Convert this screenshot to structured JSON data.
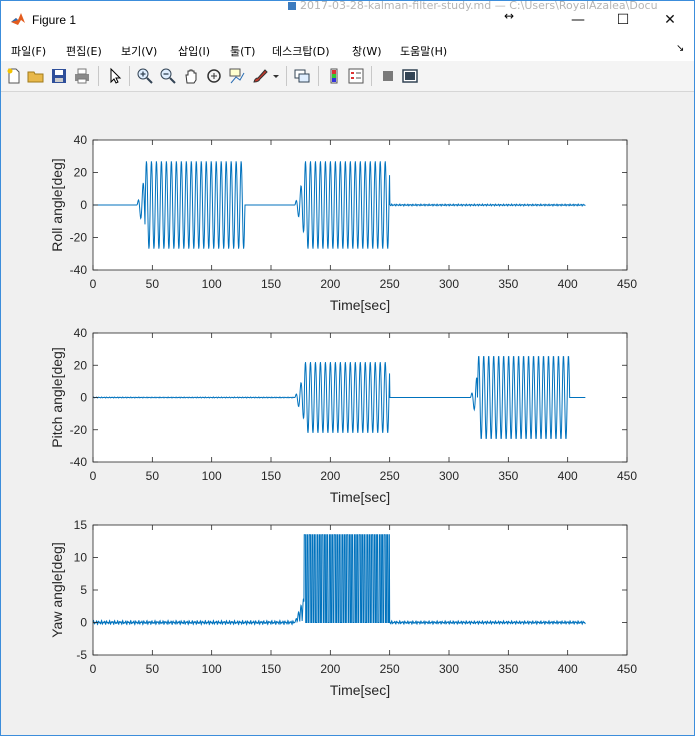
{
  "window": {
    "title": "Figure 1",
    "background_title": "2017-03-28-kalman-filter-study.md — C:\\Users\\RoyalAzalea\\Docu",
    "controls": {
      "minimize": "—",
      "maximize": "☐",
      "close": "✕"
    },
    "resize_glyph": "↔"
  },
  "menu": {
    "items": [
      "파일(F)",
      "편집(E)",
      "보기(V)",
      "삽입(I)",
      "툴(T)",
      "데스크탑(D)",
      "창(W)",
      "도움말(H)"
    ],
    "overflow_arrow": "↘"
  },
  "toolbar": {
    "icons": [
      "new-figure-icon",
      "open-file-icon",
      "save-icon",
      "print-icon",
      "pointer-icon",
      "zoom-in-icon",
      "zoom-out-icon",
      "pan-icon",
      "rotate-3d-icon",
      "data-cursor-icon",
      "brush-icon",
      "brush-dropdown-icon",
      "link-plot-icon",
      "colorbar-icon",
      "legend-icon",
      "hide-plot-tools-icon",
      "show-plot-tools-icon"
    ]
  },
  "colors": {
    "line": "#0072bd",
    "axes_bg": "#ffffff",
    "figure_bg": "#f0f0f0",
    "title_bar_border": "#3c8ddb"
  },
  "chart_data": [
    {
      "type": "line",
      "ylabel": "Roll angle[deg]",
      "xlabel": "Time[sec]",
      "xlim": [
        0,
        450
      ],
      "ylim": [
        -40,
        40
      ],
      "xticks": [
        0,
        50,
        100,
        150,
        200,
        250,
        300,
        350,
        400,
        450
      ],
      "yticks": [
        -40,
        -20,
        0,
        20,
        40
      ],
      "grid": false,
      "series": [
        {
          "x_range": [
            0,
            415
          ],
          "segments": [
            {
              "x": [
                0,
                37
              ],
              "kind": "flat",
              "value": 0
            },
            {
              "x": [
                37,
                44
              ],
              "kind": "ramp",
              "amplitude": 18
            },
            {
              "x": [
                44,
                128
              ],
              "kind": "oscillation",
              "amplitude": 27,
              "period": 4.2
            },
            {
              "x": [
                128,
                170
              ],
              "kind": "flat",
              "value": 0
            },
            {
              "x": [
                170,
                178
              ],
              "kind": "ramp",
              "amplitude": 18
            },
            {
              "x": [
                178,
                250
              ],
              "kind": "oscillation",
              "amplitude": 27,
              "period": 4.2
            },
            {
              "x": [
                250,
                415
              ],
              "kind": "noise",
              "amplitude": 0.6
            }
          ]
        }
      ]
    },
    {
      "type": "line",
      "ylabel": "Pitch angle[deg]",
      "xlabel": "Time[sec]",
      "xlim": [
        0,
        450
      ],
      "ylim": [
        -40,
        40
      ],
      "xticks": [
        0,
        50,
        100,
        150,
        200,
        250,
        300,
        350,
        400,
        450
      ],
      "yticks": [
        -40,
        -20,
        0,
        20,
        40
      ],
      "grid": false,
      "series": [
        {
          "x_range": [
            0,
            415
          ],
          "segments": [
            {
              "x": [
                0,
                170
              ],
              "kind": "noise",
              "amplitude": 0.3
            },
            {
              "x": [
                170,
                178
              ],
              "kind": "ramp",
              "amplitude": 14
            },
            {
              "x": [
                178,
                250
              ],
              "kind": "oscillation",
              "amplitude": 22,
              "period": 4.2
            },
            {
              "x": [
                250,
                318
              ],
              "kind": "flat",
              "value": 0
            },
            {
              "x": [
                318,
                324
              ],
              "kind": "ramp",
              "amplitude": 14
            },
            {
              "x": [
                324,
                402
              ],
              "kind": "oscillation",
              "amplitude": 26,
              "period": 4.2
            },
            {
              "x": [
                402,
                415
              ],
              "kind": "flat",
              "value": 0
            }
          ]
        }
      ]
    },
    {
      "type": "line",
      "ylabel": "Yaw angle[deg]",
      "xlabel": "Time[sec]",
      "xlim": [
        0,
        450
      ],
      "ylim": [
        -5,
        15
      ],
      "xticks": [
        0,
        50,
        100,
        150,
        200,
        250,
        300,
        350,
        400,
        450
      ],
      "yticks": [
        -5,
        0,
        5,
        10,
        15
      ],
      "grid": false,
      "series": [
        {
          "x_range": [
            0,
            415
          ],
          "segments": [
            {
              "x": [
                0,
                170
              ],
              "kind": "noise",
              "amplitude": 0.3
            },
            {
              "x": [
                170,
                178
              ],
              "kind": "ramp_pos",
              "amplitude": 4
            },
            {
              "x": [
                178,
                250
              ],
              "kind": "pulses",
              "low": 0,
              "high": 13.5,
              "period": 2.1
            },
            {
              "x": [
                250,
                415
              ],
              "kind": "noise",
              "amplitude": 0.25
            }
          ]
        }
      ]
    }
  ]
}
